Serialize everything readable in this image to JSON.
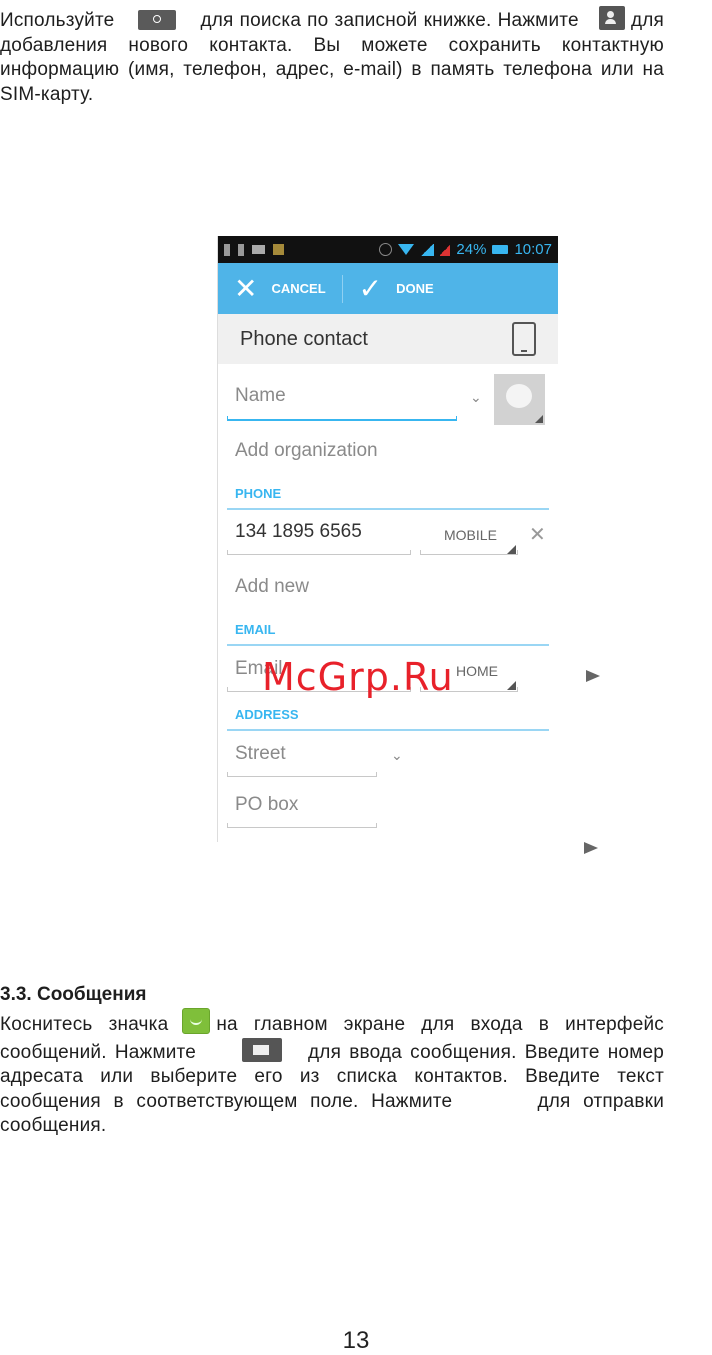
{
  "intro": {
    "part1": "Используйте",
    "part2": "для поиска по записной книжке. Нажмите",
    "part3": "для добавления нового контакта.  Вы можете сохранить контактную информацию (имя, телефон, адрес, e-mail) в память телефона или на SIM-карту."
  },
  "icons": {
    "search": "search-icon",
    "add_contact": "add-contact-icon",
    "messaging": "messaging-icon",
    "new_message": "new-message-icon",
    "send": "send-icon"
  },
  "phone": {
    "status": {
      "battery": "24%",
      "time": "10:07"
    },
    "actionbar": {
      "cancel": "CANCEL",
      "done": "DONE"
    },
    "account": "Phone contact",
    "name_placeholder": "Name",
    "add_org": "Add organization",
    "phone_header": "PHONE",
    "phone_value": "134 1895 6565",
    "phone_type": "MOBILE",
    "add_new": "Add new",
    "email_header": "EMAIL",
    "email_placeholder": "Email",
    "email_type": "HOME",
    "address_header": "ADDRESS",
    "street_placeholder": "Street",
    "pobox_placeholder": "PO box"
  },
  "watermark": "McGrp.Ru",
  "section": {
    "title": "3.3. Сообщения",
    "line1a": "Коснитесь значка",
    "line1b": "на главном экране для входа в интерфейс",
    "line2a": "сообщений. Нажмите",
    "line2b": "для ввода сообщения. Введите номер адресата или выберите его из списка контактов. Введите текст сообщения в соответствующем поле. Нажмите",
    "line2c": "для отправки сообщения."
  },
  "page_number": "13",
  "colors": {
    "accent": "#4fb4e8",
    "watermark": "#e8212a"
  }
}
